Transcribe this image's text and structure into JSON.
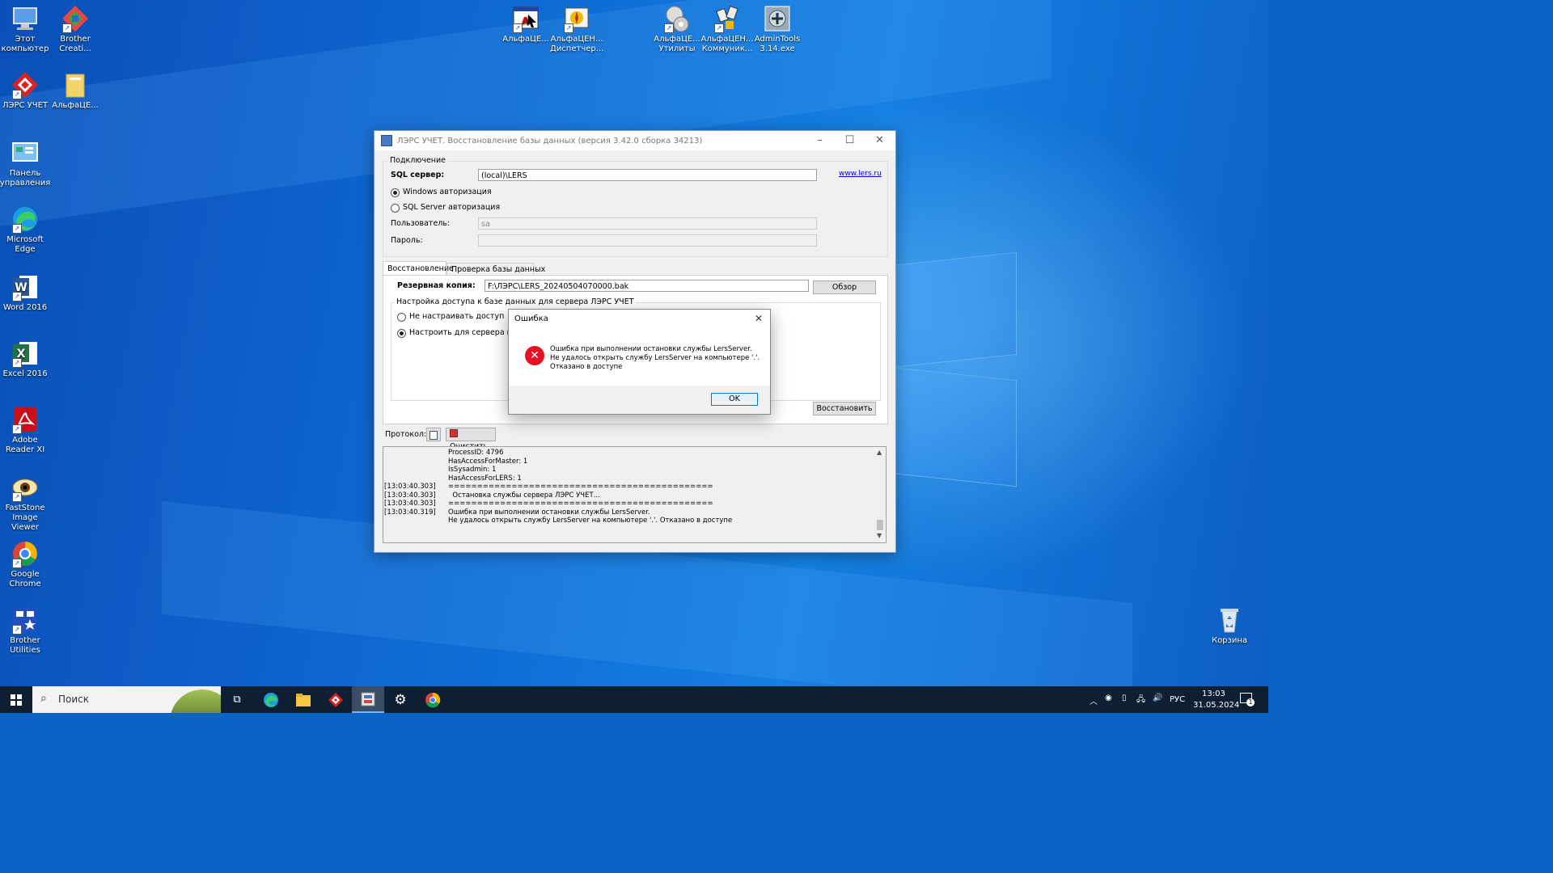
{
  "desktop": {
    "icons": [
      {
        "label": "Этот компьютер"
      },
      {
        "label": "Brother Creati..."
      },
      {
        "label": "ЛЭРС УЧЕТ"
      },
      {
        "label": "АльфаЦЕ..."
      },
      {
        "label": "Панель управления"
      },
      {
        "label": "Microsoft Edge"
      },
      {
        "label": "Word 2016"
      },
      {
        "label": "Excel 2016"
      },
      {
        "label": "Adobe Reader XI"
      },
      {
        "label": "FastStone Image Viewer"
      },
      {
        "label": "Google Chrome"
      },
      {
        "label": "Brother Utilities"
      },
      {
        "label": "АльфаЦЕ..."
      },
      {
        "label": "АльфаЦЕН... Диспетчер..."
      },
      {
        "label": "АльфаЦЕ... Утилиты"
      },
      {
        "label": "АльфаЦЕН... Коммуник..."
      },
      {
        "label": "AdminTools 3.14.exe"
      },
      {
        "label": "Корзина"
      }
    ]
  },
  "window": {
    "title": "ЛЭРС УЧЕТ. Восстановление базы данных (версия 3.42.0 сборка 34213)",
    "minimize": "–",
    "maximize": "☐",
    "close": "✕",
    "connection": {
      "group_label": "Подключение",
      "sql_server_label": "SQL сервер:",
      "sql_server_value": "(local)\\LERS",
      "website_link": "www.lers.ru",
      "auth_windows": "Windows авторизация",
      "auth_sql": "SQL Server авторизация",
      "user_label": "Пользователь:",
      "user_value": "sa",
      "password_label": "Пароль:",
      "password_value": ""
    },
    "tabs": [
      {
        "label": "Восстановление",
        "active": true
      },
      {
        "label": "Проверка базы данных",
        "active": false
      }
    ],
    "restore": {
      "backup_label": "Резервная копия:",
      "backup_value": "F:\\ЛЭРС\\LERS_20240504070000.bak",
      "browse_button": "Обзор",
      "access_group_label": "Настройка доступа к базе данных для сервера ЛЭРС УЧЕТ",
      "option_no_access": "Не настраивать доступ",
      "option_configure": "Настроить для сервера на эт",
      "restore_button": "Восстановить"
    },
    "protocol": {
      "label": "Протокол:",
      "clear_button": "Очистить",
      "lines": [
        {
          "time": "",
          "msg": "ProcessID: 4796"
        },
        {
          "time": "",
          "msg": "HasAccessForMaster: 1"
        },
        {
          "time": "",
          "msg": "IsSysadmin: 1"
        },
        {
          "time": "",
          "msg": "HasAccessForLERS: 1"
        },
        {
          "time": "[13:03:40.303]",
          "msg": "=============================================="
        },
        {
          "time": "[13:03:40.303]",
          "msg": "  Остановка службы сервера ЛЭРС УЧЕТ..."
        },
        {
          "time": "[13:03:40.303]",
          "msg": "=============================================="
        },
        {
          "time": "[13:03:40.319]",
          "msg": "Ошибка при выполнении остановки службы LersServer."
        },
        {
          "time": "",
          "msg": "Не удалось открыть службу LersServer на компьютере '.'. Отказано в доступе"
        }
      ]
    }
  },
  "error_dialog": {
    "title": "Ошибка",
    "close": "✕",
    "message_line1": "Ошибка при выполнении остановки службы LersServer.",
    "message_line2": "Не удалось открыть службу LersServer на компьютере '.'.",
    "message_line3": "Отказано в доступе",
    "ok_button": "OK"
  },
  "taskbar": {
    "search_placeholder": "Поиск",
    "language": "РУС",
    "time": "13:03",
    "date": "31.05.2024",
    "notification_count": "1"
  },
  "colors": {
    "desktop_blue": "#0f6fd6",
    "taskbar": "#0f1f33",
    "error_red": "#e81123",
    "link_blue": "#0000ee"
  }
}
